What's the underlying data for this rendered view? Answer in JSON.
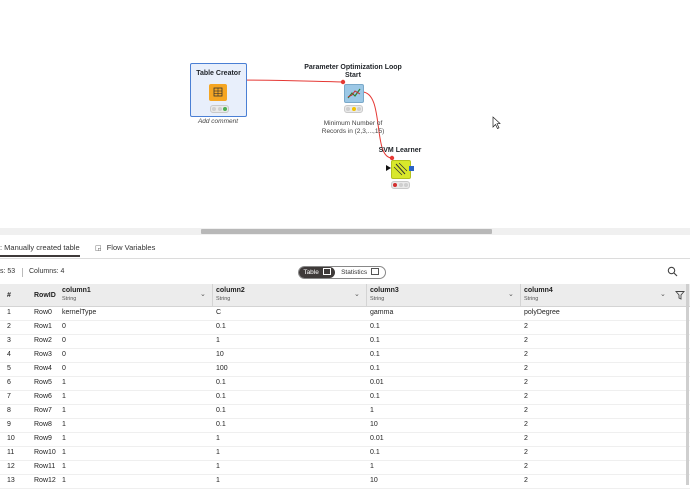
{
  "canvas": {
    "node_table_creator": {
      "title": "Table Creator",
      "annotation": "Add comment"
    },
    "node_param_loop": {
      "title_line1": "Parameter Optimization Loop",
      "title_line2": "Start",
      "desc_line1": "Minimum Number of",
      "desc_line2": "Records in (2,3,...,15)"
    },
    "node_svm": {
      "title": "SVM Learner"
    },
    "colors": {
      "connection": "#e53935",
      "node_selected": "#4a7fd4",
      "table_creator_icon": "#f5a623",
      "svm_icon": "#d8e82b",
      "loop_icon": "#9cc8e6"
    }
  },
  "panel": {
    "tabs": {
      "table": ": Manually created table",
      "flow_vars": "Flow Variables"
    },
    "info": {
      "rows": "s: 53",
      "columns": "Columns: 4"
    },
    "toggle": {
      "table": "Table",
      "statistics": "Statistics"
    }
  },
  "table": {
    "headers": {
      "index": "#",
      "rowid": "RowID",
      "c1": "column1",
      "c1_type": "String",
      "c2": "column2",
      "c2_type": "String",
      "c3": "column3",
      "c3_type": "String",
      "c4": "column4",
      "c4_type": "String"
    },
    "rows": [
      [
        "1",
        "Row0",
        "kernelType",
        "C",
        "gamma",
        "polyDegree"
      ],
      [
        "2",
        "Row1",
        "0",
        "0.1",
        "0.1",
        "2"
      ],
      [
        "3",
        "Row2",
        "0",
        "1",
        "0.1",
        "2"
      ],
      [
        "4",
        "Row3",
        "0",
        "10",
        "0.1",
        "2"
      ],
      [
        "5",
        "Row4",
        "0",
        "100",
        "0.1",
        "2"
      ],
      [
        "6",
        "Row5",
        "1",
        "0.1",
        "0.01",
        "2"
      ],
      [
        "7",
        "Row6",
        "1",
        "0.1",
        "0.1",
        "2"
      ],
      [
        "8",
        "Row7",
        "1",
        "0.1",
        "1",
        "2"
      ],
      [
        "9",
        "Row8",
        "1",
        "0.1",
        "10",
        "2"
      ],
      [
        "10",
        "Row9",
        "1",
        "1",
        "0.01",
        "2"
      ],
      [
        "11",
        "Row10",
        "1",
        "1",
        "0.1",
        "2"
      ],
      [
        "12",
        "Row11",
        "1",
        "1",
        "1",
        "2"
      ],
      [
        "13",
        "Row12",
        "1",
        "1",
        "10",
        "2"
      ]
    ]
  }
}
